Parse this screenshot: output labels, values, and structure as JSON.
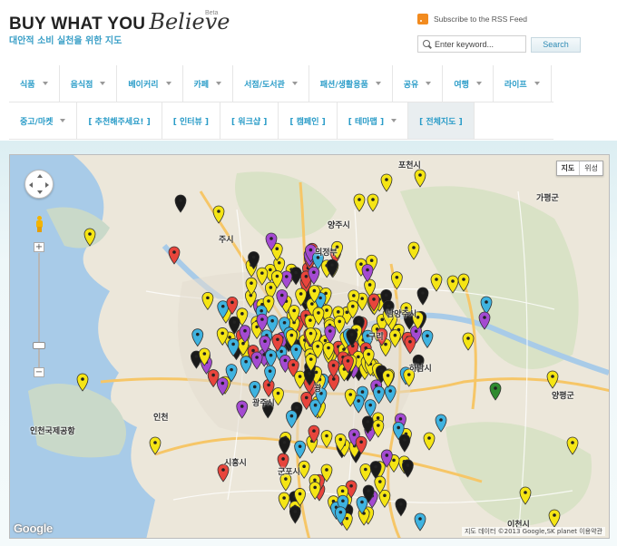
{
  "header": {
    "brand_main": "BUY WHAT YOU",
    "brand_script": "Believe",
    "brand_beta": "Beta",
    "tagline": "대안적 소비 실천을 위한 지도"
  },
  "rss": {
    "label": "Subscribe to the RSS Feed"
  },
  "search": {
    "placeholder": "Enter keyword...",
    "button": "Search"
  },
  "nav": {
    "row1": [
      {
        "label": "식품",
        "dropdown": true
      },
      {
        "label": "음식점",
        "dropdown": true
      },
      {
        "label": "베이커리",
        "dropdown": true
      },
      {
        "label": "카페",
        "dropdown": true
      },
      {
        "label": "서점/도서관",
        "dropdown": true
      },
      {
        "label": "패션/생활용품",
        "dropdown": true
      },
      {
        "label": "공유",
        "dropdown": true
      },
      {
        "label": "여행",
        "dropdown": true
      },
      {
        "label": "라이프",
        "dropdown": true
      }
    ],
    "row2": [
      {
        "label": "중고/마켓",
        "dropdown": true
      },
      {
        "label": "[ 추천해주세요! ]",
        "dropdown": false
      },
      {
        "label": "[ 인터뷰 ]",
        "dropdown": false
      },
      {
        "label": "[ 워크샵 ]",
        "dropdown": false
      },
      {
        "label": "[ 캠페인 ]",
        "dropdown": false
      },
      {
        "label": "[ 테마맵 ]",
        "dropdown": true
      },
      {
        "label": "[ 전체지도 ]",
        "dropdown": false,
        "active": true
      }
    ]
  },
  "map": {
    "type_buttons": [
      "지도",
      "위성"
    ],
    "active_type": "지도",
    "attribution": "지도 데이터 ©2013 Google,SK planet   이용약관",
    "logo": "Google",
    "place_labels": [
      {
        "text": "포천시"
      },
      {
        "text": "가평군"
      },
      {
        "text": "양주시"
      },
      {
        "text": "의정부"
      },
      {
        "text": "남양주시"
      },
      {
        "text": "주시"
      },
      {
        "text": "하남시"
      },
      {
        "text": "양평군"
      },
      {
        "text": "광주시"
      },
      {
        "text": "인천국제공항"
      },
      {
        "text": "시흥시"
      },
      {
        "text": "군포시"
      },
      {
        "text": "이천시"
      },
      {
        "text": "구리"
      },
      {
        "text": "인천"
      },
      {
        "text": "광"
      }
    ],
    "marker_colors": {
      "yellow": "#f5e514",
      "red": "#e8453c",
      "blue": "#3fb3e0",
      "purple": "#a44ad1",
      "black": "#1a1a1a",
      "green": "#2f8a2f"
    }
  }
}
